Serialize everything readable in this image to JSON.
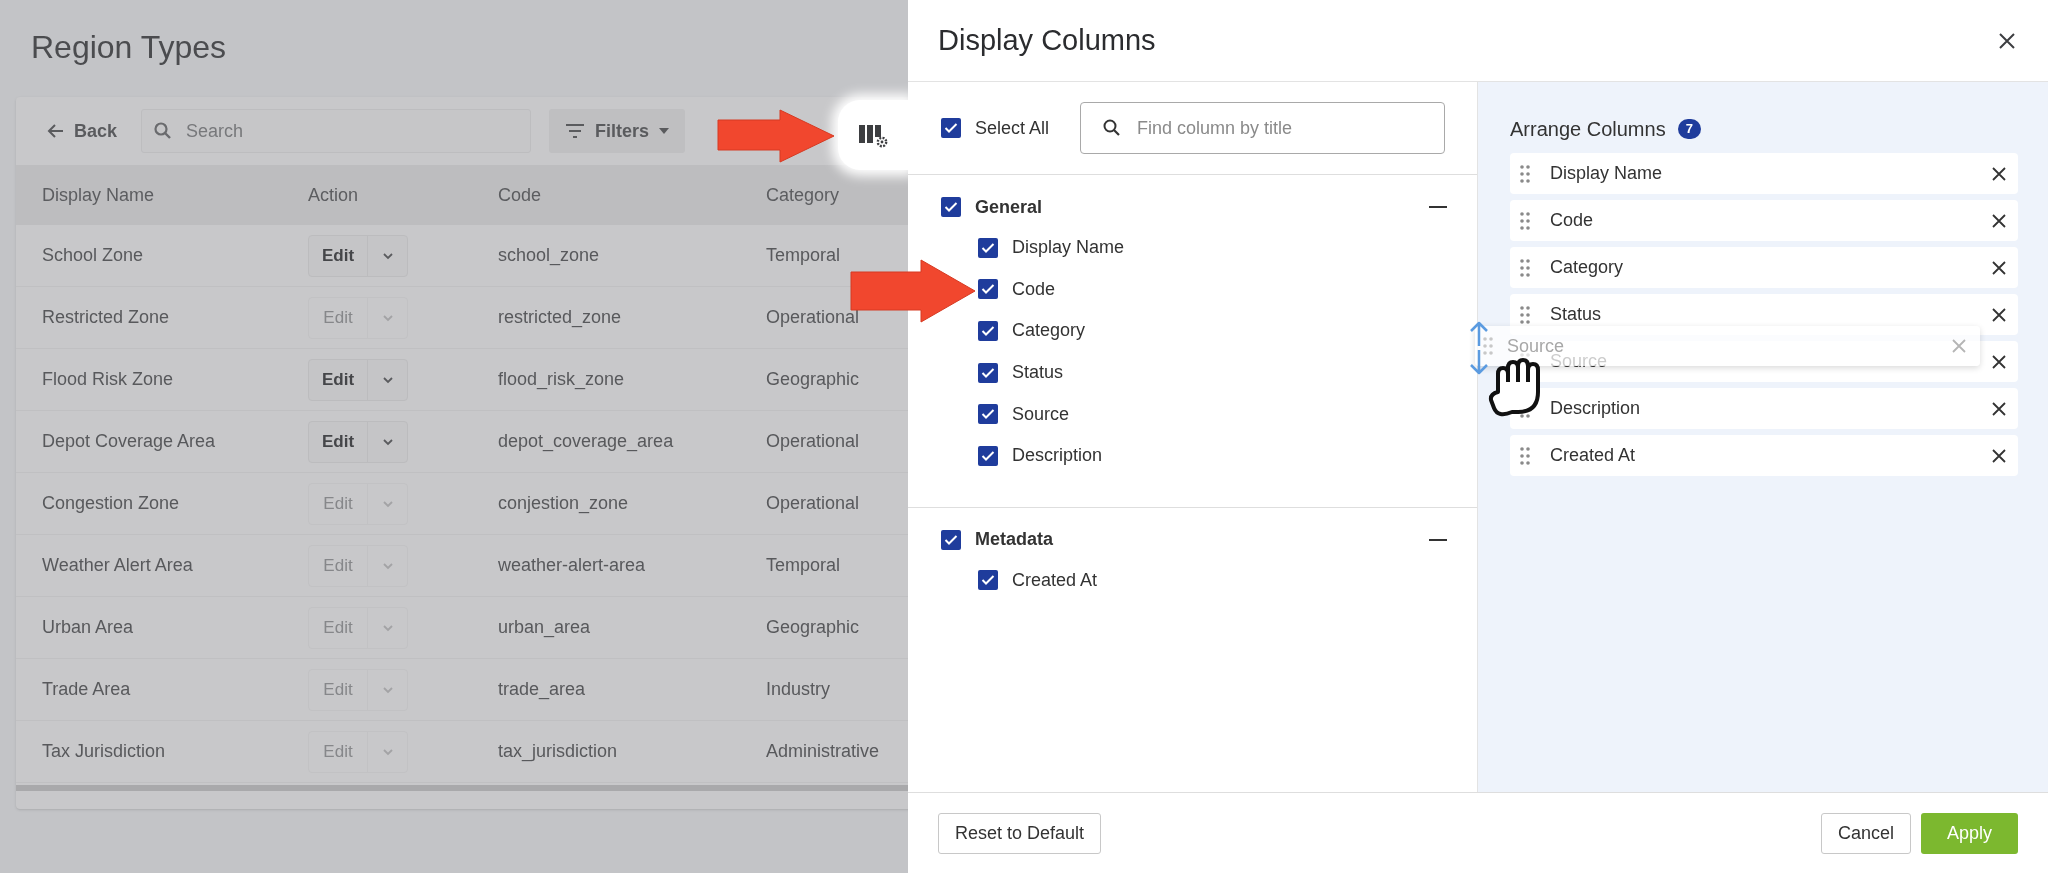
{
  "page": {
    "title": "Region Types",
    "toolbar": {
      "back": "Back",
      "search_placeholder": "Search",
      "filters": "Filters"
    },
    "table": {
      "columns": [
        "Display Name",
        "Action",
        "Code",
        "Category"
      ],
      "rows": [
        {
          "display_name": "School Zone",
          "action": "Edit",
          "disabled": false,
          "code": "school_zone",
          "category": "Temporal"
        },
        {
          "display_name": "Restricted Zone",
          "action": "Edit",
          "disabled": true,
          "code": "restricted_zone",
          "category": "Operational"
        },
        {
          "display_name": "Flood Risk Zone",
          "action": "Edit",
          "disabled": false,
          "code": "flood_risk_zone",
          "category": "Geographic"
        },
        {
          "display_name": "Depot Coverage Area",
          "action": "Edit",
          "disabled": false,
          "code": "depot_coverage_area",
          "category": "Operational"
        },
        {
          "display_name": "Congestion Zone",
          "action": "Edit",
          "disabled": true,
          "code": "conjestion_zone",
          "category": "Operational"
        },
        {
          "display_name": "Weather Alert Area",
          "action": "Edit",
          "disabled": true,
          "code": "weather-alert-area",
          "category": "Temporal"
        },
        {
          "display_name": "Urban Area",
          "action": "Edit",
          "disabled": true,
          "code": "urban_area",
          "category": "Geographic"
        },
        {
          "display_name": "Trade Area",
          "action": "Edit",
          "disabled": true,
          "code": "trade_area",
          "category": "Industry"
        },
        {
          "display_name": "Tax Jurisdiction",
          "action": "Edit",
          "disabled": true,
          "code": "tax_jurisdiction",
          "category": "Administrative"
        }
      ]
    }
  },
  "panel": {
    "title": "Display Columns",
    "select_all": {
      "label": "Select All",
      "checked": true
    },
    "search": {
      "placeholder": "Find column by title"
    },
    "groups": [
      {
        "label": "General",
        "checked": true,
        "expanded": true,
        "children": [
          {
            "label": "Display Name",
            "checked": true
          },
          {
            "label": "Code",
            "checked": true
          },
          {
            "label": "Category",
            "checked": true
          },
          {
            "label": "Status",
            "checked": true
          },
          {
            "label": "Source",
            "checked": true
          },
          {
            "label": "Description",
            "checked": true
          }
        ]
      },
      {
        "label": "Metadata",
        "checked": true,
        "expanded": true,
        "children": [
          {
            "label": "Created At",
            "checked": true
          }
        ]
      }
    ],
    "arrange": {
      "title": "Arrange Columns",
      "count": "7",
      "items": [
        {
          "label": "Display Name"
        },
        {
          "label": "Code"
        },
        {
          "label": "Category"
        },
        {
          "label": "Status"
        },
        {
          "label": "Source"
        },
        {
          "label": "Description"
        },
        {
          "label": "Created At"
        }
      ],
      "dragging": {
        "label": "Source"
      }
    },
    "footer": {
      "reset": "Reset to Default",
      "cancel": "Cancel",
      "apply": "Apply"
    }
  }
}
